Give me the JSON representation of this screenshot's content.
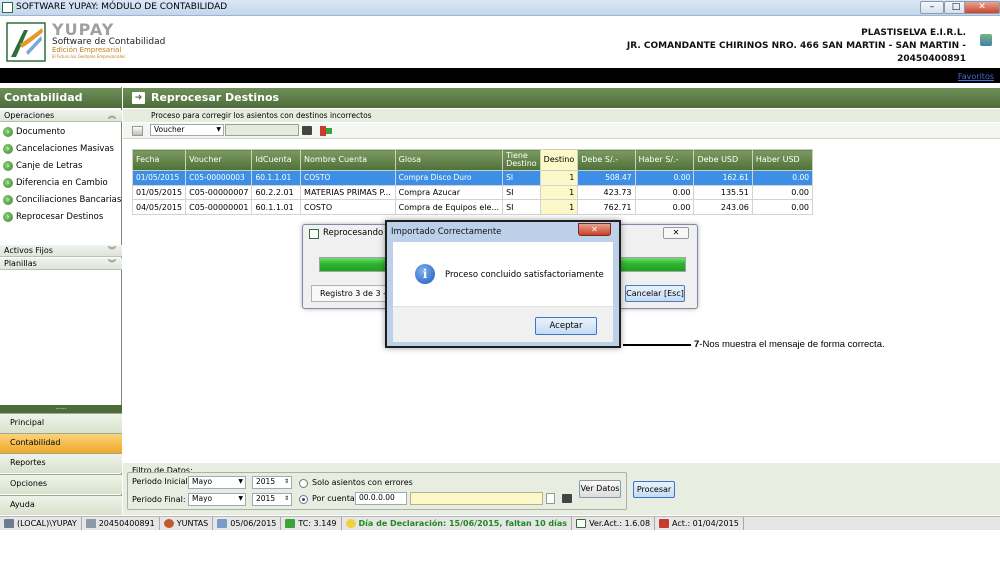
{
  "window": {
    "title": "SOFTWARE YUPAY: MÓDULO DE CONTABILIDAD",
    "min": "–",
    "max": "□",
    "close": "✕"
  },
  "brand": {
    "name": "YUPAY",
    "subtitle": "Software de Contabilidad",
    "edition": "Edición Empresarial",
    "tagline": "El Futuro los Gestores Empresariales"
  },
  "company": {
    "name": "PLASTISELVA E.I.R.L.",
    "address": "JR. COMANDANTE CHIRINOS NRO. 466 SAN MARTIN - SAN MARTIN -",
    "ruc": "20450400891"
  },
  "favorites": "Favoritos",
  "sidebar": {
    "title": "Contabilidad",
    "section_operaciones": "Operaciones",
    "items": [
      {
        "label": "Documento"
      },
      {
        "label": "Cancelaciones Masivas"
      },
      {
        "label": "Canje de Letras"
      },
      {
        "label": "Diferencia en Cambio"
      },
      {
        "label": "Conciliaciones Bancarias"
      },
      {
        "label": "Reprocesar Destinos"
      }
    ],
    "section_activos": "Activos Fijos",
    "section_planillas": "Planillas",
    "splitter": "......",
    "bottom_tabs": [
      "Principal",
      "Contabilidad",
      "Reportes",
      "Opciones",
      "Ayuda"
    ]
  },
  "main": {
    "title": "Reprocesar Destinos",
    "subtitle": "Proceso para corregir los asientos con destinos incorrectos",
    "toolbar_select": "Voucher"
  },
  "grid": {
    "headers": [
      "Fecha",
      "Voucher",
      "IdCuenta",
      "Nombre Cuenta",
      "Glosa",
      "Tiene Destino",
      "Destino",
      "Debe S/.-",
      "Haber S/.-",
      "Debe USD",
      "Haber USD"
    ],
    "rows": [
      [
        "01/05/2015",
        "C05-00000003",
        "60.1.1.01",
        "COSTO",
        "Compra Disco Duro",
        "SI",
        "1",
        "508.47",
        "0.00",
        "162.61",
        "0.00"
      ],
      [
        "01/05/2015",
        "C05-00000007",
        "60.2.2.01",
        "MATERIAS PRIMAS P...",
        "Compra Azucar",
        "SI",
        "1",
        "423.73",
        "0.00",
        "135.51",
        "0.00"
      ],
      [
        "04/05/2015",
        "C05-00000001",
        "60.1.1.01",
        "COSTO",
        "Compra de Equipos ele...",
        "SI",
        "1",
        "762.71",
        "0.00",
        "243.06",
        "0.00"
      ]
    ]
  },
  "progress": {
    "title": "Reprocesando D",
    "status": "Registro 3 de 3 --",
    "cancel": "Cancelar [Esc]",
    "close": "✕",
    "percent": 100
  },
  "message": {
    "title": "Importado Correctamente",
    "text": "Proceso concluido satisfactoriamente",
    "ok": "Aceptar",
    "close": "✕",
    "icon": "i"
  },
  "annotation": {
    "num": "7",
    "text": "-Nos muestra el mensaje de forma correcta."
  },
  "filter": {
    "group": "Filtro de Datos:",
    "inicial_label": "Periodo Inicial:",
    "inicial_mes": "Mayo",
    "inicial_anio": "2015",
    "final_label": "Periodo Final:",
    "final_mes": "Mayo",
    "final_anio": "2015",
    "radio1": "Solo asientos con errores",
    "radio2": "Por cuenta",
    "cuenta": "00.0.0.00",
    "ver_datos": "Ver Datos",
    "procesar": "Procesar"
  },
  "statusbar": {
    "server": "(LOCAL)\\YUPAY",
    "ruc": "20450400891",
    "user": "YUNTAS",
    "date": "05/06/2015",
    "tc": "TC: 3.149",
    "declaracion": "Día de Declaración: 15/06/2015, faltan 10 días",
    "version": "Ver.Act.: 1.6.08",
    "act": "Act.: 01/04/2015"
  }
}
